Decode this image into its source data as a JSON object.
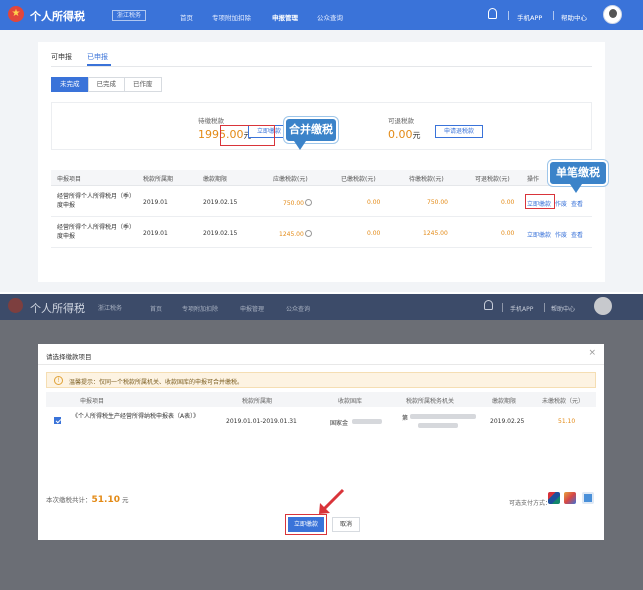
{
  "header": {
    "app_title": "个人所得税",
    "region": "浙江税务",
    "nav_items": [
      "首页",
      "专项附加扣除",
      "申报管理",
      "公众查询"
    ],
    "active_nav": "申报管理",
    "mobile_app": "手机APP",
    "help_center": "帮助中心"
  },
  "declare_page": {
    "tabs": [
      "可申报",
      "已申报"
    ],
    "active_tab": "已申报",
    "status_filters": [
      "未完成",
      "已完成",
      "已作废"
    ],
    "active_filter": "未完成",
    "pending": {
      "label": "待缴税款",
      "amount": "1995.00",
      "unit": "元",
      "button": "立即缴款",
      "callout": "合并缴税"
    },
    "refund": {
      "label": "可退税款",
      "amount": "0.00",
      "unit": "元",
      "button": "申请退税款"
    },
    "single_callout": "单笔缴税",
    "table": {
      "headers": [
        "申报项目",
        "税款所属期",
        "缴款期限",
        "应缴税款(元)",
        "已缴税款(元)",
        "待缴税款(元)",
        "可退税款(元)",
        "操作"
      ],
      "rows": [
        {
          "name": "经营所得个人所得税月（季）度申报",
          "period": "2019.01",
          "deadline": "2019.02.15",
          "payable": "750.00",
          "paid": "0.00",
          "pending": "750.00",
          "refundable": "0.00",
          "actions": [
            "立即缴款",
            "作废",
            "查看"
          ]
        },
        {
          "name": "经营所得个人所得税月（季）度申报",
          "period": "2019.01",
          "deadline": "2019.02.15",
          "payable": "1245.00",
          "paid": "0.00",
          "pending": "1245.00",
          "refundable": "0.00",
          "actions": [
            "立即缴款",
            "作废",
            "查看"
          ]
        }
      ]
    }
  },
  "modal": {
    "title": "请选择缴款项目",
    "notice": "温馨提示：仅同一个税款所属机关、收款国库的申报可合并缴税。",
    "headers": [
      "申报项目",
      "税款所属期",
      "收款国库",
      "税款所属税务机关",
      "缴款期限",
      "未缴税款（元）"
    ],
    "row": {
      "name": "《个人所得税生产经营所得纳税申报表（A表）》",
      "period": "2019.01.01-2019.01.31",
      "treasury": "国家金",
      "tax_office_prefix": "第",
      "deadline": "2019.02.25",
      "amount": "51.10"
    },
    "total_label": "本次缴税共计：",
    "total_value": "51.10",
    "total_unit": "元",
    "pay_methods_label": "可选支付方式：",
    "pay_button": "立即缴款",
    "cancel_button": "取消"
  }
}
